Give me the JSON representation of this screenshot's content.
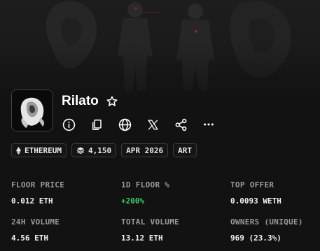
{
  "collection": {
    "name": "Rilato",
    "avatar": "ghost-art-avatar"
  },
  "actions": [
    {
      "icon": "info-icon"
    },
    {
      "icon": "copy-icon"
    },
    {
      "icon": "globe-icon"
    },
    {
      "icon": "x-icon"
    },
    {
      "icon": "share-icon"
    },
    {
      "icon": "more-icon"
    }
  ],
  "tags": {
    "chain": "ETHEREUM",
    "items": "4,150",
    "date": "APR 2026",
    "category": "ART"
  },
  "stats": {
    "floor_price": {
      "label": "FLOOR PRICE",
      "value": "0.012 ETH"
    },
    "floor_change": {
      "label": "1D FLOOR %",
      "value": "+200%"
    },
    "top_offer": {
      "label": "TOP OFFER",
      "value": "0.0093 WETH"
    },
    "volume_24h": {
      "label": "24H VOLUME",
      "value": "4.56 ETH"
    },
    "total_volume": {
      "label": "TOTAL VOLUME",
      "value": "13.12 ETH"
    },
    "owners": {
      "label": "OWNERS (UNIQUE)",
      "value": "969 (23.3%)"
    }
  },
  "colors": {
    "background": "#121212",
    "positive": "#3fcf6a",
    "label": "#9a9a9a"
  }
}
